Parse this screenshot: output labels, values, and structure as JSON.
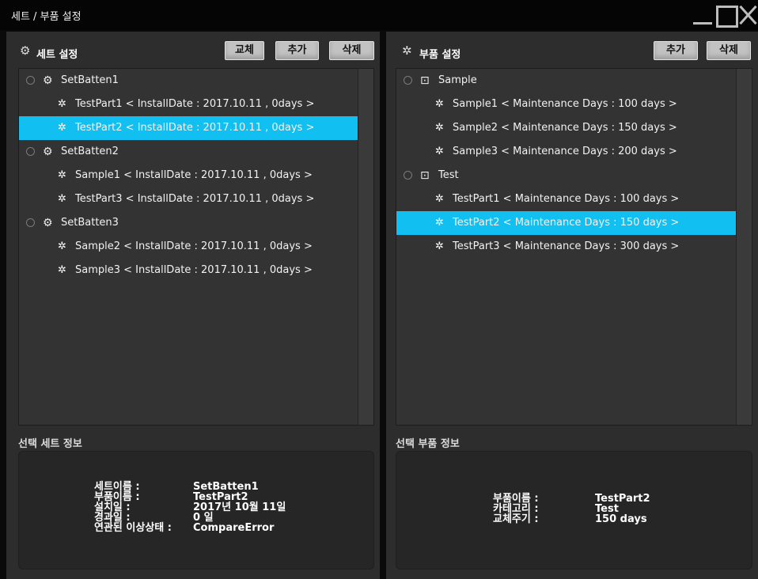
{
  "window": {
    "title": "세트 / 부품 설정"
  },
  "left": {
    "title": "세트 설정",
    "buttons": {
      "replace": "교체",
      "add": "추가",
      "delete": "삭제"
    },
    "tree": [
      {
        "label": "SetBatten1",
        "items": [
          "TestPart1 < InstallDate : 2017.10.11 , 0days >",
          "TestPart2 < InstallDate : 2017.10.11 , 0days >"
        ]
      },
      {
        "label": "SetBatten2",
        "items": [
          "Sample1 < InstallDate : 2017.10.11 , 0days >",
          "TestPart3 < InstallDate : 2017.10.11 , 0days >"
        ]
      },
      {
        "label": "SetBatten3",
        "items": [
          "Sample2 < InstallDate : 2017.10.11 , 0days >",
          "Sample3 < InstallDate : 2017.10.11 , 0days >"
        ]
      }
    ],
    "selected_item": "TestPart2 < InstallDate : 2017.10.11 , 0days >",
    "info": {
      "title": "선택 세트 정보",
      "labels": [
        "세트이름 :",
        "부품이름 :",
        "설치일 :",
        "경과일 :",
        "연관된 이상상태 :"
      ],
      "values": [
        "SetBatten1",
        "TestPart2",
        "2017년 10월 11일",
        "0 일",
        "CompareError"
      ]
    }
  },
  "right": {
    "title": "부품 설정",
    "buttons": {
      "add": "추가",
      "delete": "삭제"
    },
    "tree": [
      {
        "label": "Sample",
        "items": [
          "Sample1 < Maintenance Days : 100 days >",
          "Sample2 < Maintenance Days : 150 days >",
          "Sample3 < Maintenance Days : 200 days >"
        ]
      },
      {
        "label": "Test",
        "items": [
          "TestPart1 < Maintenance Days : 100 days >",
          "TestPart2 < Maintenance Days : 150 days >",
          "TestPart3 < Maintenance Days : 300 days >"
        ]
      }
    ],
    "selected_item": "TestPart2 < Maintenance Days : 150 days >",
    "info": {
      "title": "선택 부품 정보",
      "labels": [
        "부품이름 :",
        "카테고리 :",
        "교체주기 :"
      ],
      "values": [
        "TestPart2",
        "Test",
        "150 days"
      ]
    }
  },
  "colors": {
    "selection": "#11bff0",
    "panel": "#2d2d2d",
    "tree_bg": "#333333",
    "button": "#c2c2c2"
  },
  "icons": {
    "set": "gears-icon",
    "part": "gear-icon",
    "category": "chip-icon",
    "radio": "radio-icon"
  }
}
